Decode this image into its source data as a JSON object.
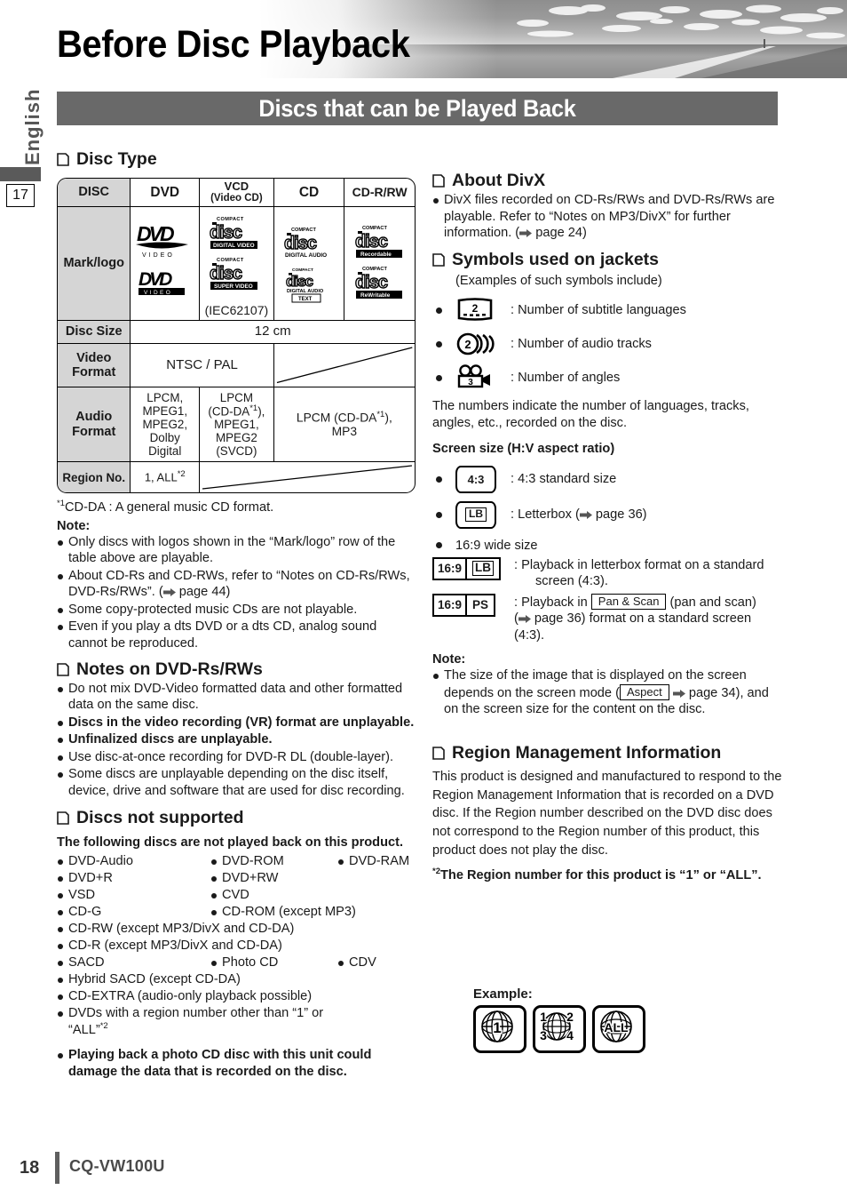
{
  "page": {
    "title": "Before Disc Playback",
    "language_tab": "English",
    "chapter_tab": "17",
    "section_banner": "Discs that can be Played Back",
    "footer_page_number": "18",
    "footer_model": "CQ-VW100U"
  },
  "disc_type": {
    "heading": "Disc Type",
    "columns": [
      "DISC",
      "DVD",
      "VCD",
      "CD",
      "CD-R/RW"
    ],
    "vcd_sub": "(Video CD)",
    "rows": [
      {
        "label": "Mark/logo",
        "values": [
          "DVD VIDEO / DVD VIDEO",
          "COMPACT disc DIGITAL VIDEO / COMPACT disc SUPER VIDEO (IEC62107)",
          "COMPACT disc DIGITAL AUDIO / COMPACT disc DIGITAL AUDIO TEXT",
          "COMPACT disc Recordable / COMPACT disc ReWritable"
        ]
      },
      {
        "label": "Disc Size",
        "merged": "12 cm"
      },
      {
        "label": "Video Format",
        "value": "NTSC / PAL"
      },
      {
        "label": "Audio Format",
        "dvd": "LPCM, MPEG1, MPEG2, Dolby Digital",
        "vcd": "LPCM (CD-DA*1), MPEG1, MPEG2 (SVCD)",
        "cd": "LPCM (CD-DA*1), MP3"
      },
      {
        "label": "Region No.",
        "value": "1, ALL *2"
      }
    ],
    "dvd_logo_text": "DVD",
    "dvd_logo_sub": "VIDEO",
    "cd_logo_word": "disc",
    "cd_logo_compact": "COMPACT",
    "cd_badges": [
      "DIGITAL VIDEO",
      "SUPER VIDEO",
      "DIGITAL AUDIO",
      "TEXT",
      "Recordable",
      "ReWritable"
    ],
    "iec_note": "(IEC62107)",
    "disc_size_value": "12 cm",
    "video_format_value": "NTSC / PAL",
    "audio_dvd": [
      "LPCM,",
      "MPEG1,",
      "MPEG2,",
      "Dolby",
      "Digital"
    ],
    "audio_vcd": [
      "LPCM",
      "(CD-DA*1),",
      "MPEG1,",
      "MPEG2",
      "(SVCD)"
    ],
    "audio_cd": [
      "LPCM (CD-DA*1),",
      "MP3"
    ],
    "region_value": "1, ALL"
  },
  "footnote1": "CD-DA : A general music CD format.",
  "note_label": "Note:",
  "notes_left": [
    "Only discs with logos shown in the “Mark/logo” row of the table above are playable.",
    "About CD-Rs and CD-RWs, refer to “Notes on CD-Rs/RWs, DVD-Rs/RWs”. (➜ page 44)",
    "Some copy-protected music CDs are not playable.",
    "Even if you play a dts DVD or a dts CD, analog sound cannot be reproduced."
  ],
  "dvd_rs_rws": {
    "heading": "Notes on DVD-Rs/RWs",
    "items": [
      {
        "text": "Do not mix DVD-Video formatted data and other formatted data on the same disc.",
        "bold": false
      },
      {
        "text": "Discs in the video recording (VR) format are unplayable.",
        "bold": true
      },
      {
        "text": "Unfinalized discs are unplayable.",
        "bold": true
      },
      {
        "text": "Use disc-at-once recording for DVD-R DL (double-layer).",
        "bold": false
      },
      {
        "text": "Some discs are unplayable depending on the disc itself, device, drive and software that are used for disc recording.",
        "bold": false
      }
    ]
  },
  "not_supported": {
    "heading": "Discs not supported",
    "intro": "The following discs are not played back on this product.",
    "rows": [
      [
        "DVD-Audio",
        "DVD-ROM",
        "DVD-RAM"
      ],
      [
        "DVD+R",
        "DVD+RW"
      ],
      [
        "VSD",
        "CVD"
      ],
      [
        "CD-G",
        "CD-ROM (except MP3)"
      ],
      [
        "CD-RW (except MP3/DivX and CD-DA)"
      ],
      [
        "CD-R (except MP3/DivX and CD-DA)"
      ],
      [
        "SACD",
        "Photo CD",
        "CDV"
      ],
      [
        "Hybrid SACD (except CD-DA)"
      ],
      [
        "CD-EXTRA (audio-only playback possible)"
      ],
      [
        "DVDs with a region number other than “1” or “ALL”*2"
      ]
    ],
    "warning": "Playing back a photo CD disc with this unit could damage the data that is recorded on the disc."
  },
  "about_divx": {
    "heading": "About DivX",
    "body": "DivX files recorded on CD-Rs/RWs and DVD-Rs/RWs are playable. Refer to “Notes on MP3/DivX” for further information. (➜ page 24)"
  },
  "symbols": {
    "heading": "Symbols used on jackets",
    "subtitle": "(Examples of such symbols include)",
    "items": [
      {
        "icon": "subtitle-symbol",
        "value": "2",
        "text": ": Number of subtitle languages"
      },
      {
        "icon": "audio-tracks-symbol",
        "value": "2",
        "text": ": Number of audio tracks"
      },
      {
        "icon": "angles-symbol",
        "value": "3",
        "text": ": Number of angles"
      }
    ],
    "note": "The numbers indicate the number of languages, tracks, angles, etc., recorded on the disc."
  },
  "screen_size": {
    "heading": "Screen size (H:V aspect ratio)",
    "items": [
      {
        "badge": "4:3",
        "text": ": 4:3 standard size"
      },
      {
        "badge": "LB",
        "text": ": Letterbox (➜ page 36)"
      }
    ],
    "wide_label": "16:9 wide size",
    "wide_rows": [
      {
        "left": "16:9",
        "right": "LB",
        "text": ": Playback in letterbox format on a standard screen (4:3)."
      },
      {
        "left": "16:9",
        "right": "PS",
        "text_a": ": Playback in ",
        "inline_box": "Pan & Scan",
        "text_b": " (pan and scan) (➜ page 36) format on a standard screen (4:3)."
      }
    ],
    "note_label": "Note:",
    "note_a": "The size of the image that is displayed on the screen depends on the screen mode (",
    "note_box": "Aspect",
    "note_b": " ➜ page 34), and on the screen size for the content on the disc."
  },
  "region_mgmt": {
    "heading": "Region Management Information",
    "body": "This product is designed and manufactured to respond to the Region Management Information that is recorded on a DVD disc. If the Region number described on the DVD disc does not correspond to the Region number of this product, this product does not play the disc.",
    "footnote2": "The Region number for this product is “1” or “ALL”.",
    "example_label": "Example:",
    "example_icons": [
      {
        "name": "region-globe-1",
        "text": "1"
      },
      {
        "name": "region-globe-1234",
        "text": "1 2 3 4"
      },
      {
        "name": "region-globe-all",
        "text": "ALL"
      }
    ]
  },
  "colors": {
    "banner": "#696969",
    "table_header_fill": "#d5d5d5",
    "ink": "#1a1a1a"
  }
}
